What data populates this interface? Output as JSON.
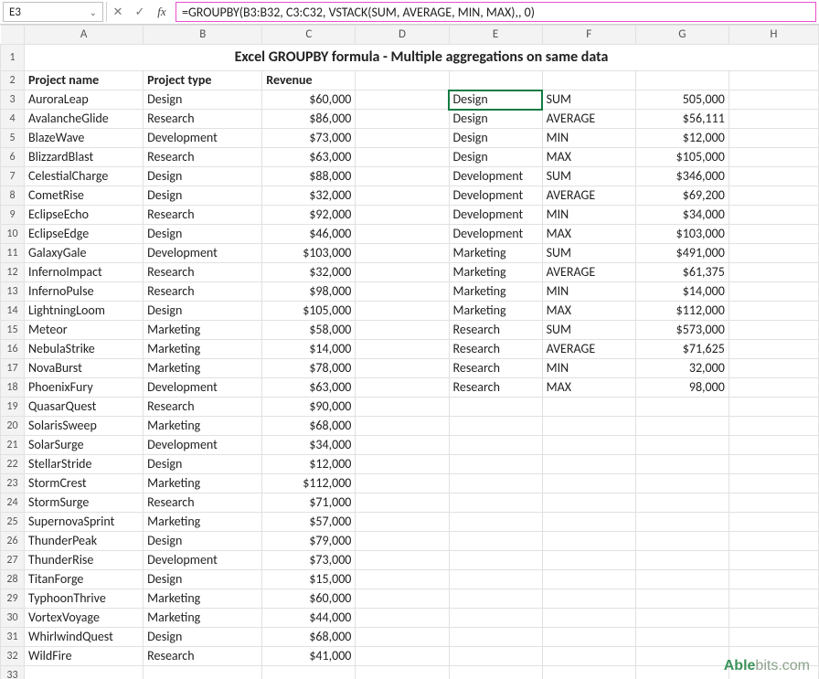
{
  "name_box": "E3",
  "formula": "=GROUPBY(B3:B32, C3:C32, VSTACK(SUM, AVERAGE, MIN, MAX),, 0)",
  "columns": [
    "A",
    "B",
    "C",
    "D",
    "E",
    "F",
    "G",
    "H"
  ],
  "title": "Excel GROUPBY formula - Multiple aggregations on same data",
  "headers": {
    "A": "Project name",
    "B": "Project type",
    "C": "Revenue"
  },
  "rows": [
    3,
    4,
    5,
    6,
    7,
    8,
    9,
    10,
    11,
    12,
    13,
    14,
    15,
    16,
    17,
    18,
    19,
    20,
    21,
    22,
    23,
    24,
    25,
    26,
    27,
    28,
    29,
    30,
    31,
    32,
    33
  ],
  "source_data": [
    {
      "name": "AuroraLeap",
      "type": "Design",
      "rev": "$60,000"
    },
    {
      "name": "AvalancheGlide",
      "type": "Research",
      "rev": "$86,000"
    },
    {
      "name": "BlazeWave",
      "type": "Development",
      "rev": "$73,000"
    },
    {
      "name": "BlizzardBlast",
      "type": "Research",
      "rev": "$63,000"
    },
    {
      "name": "CelestialCharge",
      "type": "Design",
      "rev": "$88,000"
    },
    {
      "name": "CometRise",
      "type": "Design",
      "rev": "$32,000"
    },
    {
      "name": "EclipseEcho",
      "type": "Research",
      "rev": "$92,000"
    },
    {
      "name": "EclipseEdge",
      "type": "Design",
      "rev": "$46,000"
    },
    {
      "name": "GalaxyGale",
      "type": "Development",
      "rev": "$103,000"
    },
    {
      "name": "InfernoImpact",
      "type": "Research",
      "rev": "$32,000"
    },
    {
      "name": "InfernoPulse",
      "type": "Research",
      "rev": "$98,000"
    },
    {
      "name": "LightningLoom",
      "type": "Design",
      "rev": "$105,000"
    },
    {
      "name": "Meteor",
      "type": "Marketing",
      "rev": "$58,000"
    },
    {
      "name": "NebulaStrike",
      "type": "Marketing",
      "rev": "$14,000"
    },
    {
      "name": "NovaBurst",
      "type": "Marketing",
      "rev": "$78,000"
    },
    {
      "name": "PhoenixFury",
      "type": "Development",
      "rev": "$63,000"
    },
    {
      "name": "QuasarQuest",
      "type": "Research",
      "rev": "$90,000"
    },
    {
      "name": "SolarisSweep",
      "type": "Marketing",
      "rev": "$68,000"
    },
    {
      "name": "SolarSurge",
      "type": "Development",
      "rev": "$34,000"
    },
    {
      "name": "StellarStride",
      "type": "Design",
      "rev": "$12,000"
    },
    {
      "name": "StormCrest",
      "type": "Marketing",
      "rev": "$112,000"
    },
    {
      "name": "StormSurge",
      "type": "Research",
      "rev": "$71,000"
    },
    {
      "name": "SupernovaSprint",
      "type": "Marketing",
      "rev": "$57,000"
    },
    {
      "name": "ThunderPeak",
      "type": "Design",
      "rev": "$79,000"
    },
    {
      "name": "ThunderRise",
      "type": "Development",
      "rev": "$73,000"
    },
    {
      "name": "TitanForge",
      "type": "Design",
      "rev": "$15,000"
    },
    {
      "name": "TyphoonThrive",
      "type": "Marketing",
      "rev": "$60,000"
    },
    {
      "name": "VortexVoyage",
      "type": "Marketing",
      "rev": "$44,000"
    },
    {
      "name": "WhirlwindQuest",
      "type": "Design",
      "rev": "$68,000"
    },
    {
      "name": "WildFire",
      "type": "Research",
      "rev": "$41,000"
    }
  ],
  "spill_data": [
    {
      "e": "Design",
      "f": "SUM",
      "g": "505,000"
    },
    {
      "e": "Design",
      "f": "AVERAGE",
      "g": "$56,111"
    },
    {
      "e": "Design",
      "f": "MIN",
      "g": "$12,000"
    },
    {
      "e": "Design",
      "f": "MAX",
      "g": "$105,000"
    },
    {
      "e": "Development",
      "f": "SUM",
      "g": "$346,000"
    },
    {
      "e": "Development",
      "f": "AVERAGE",
      "g": "$69,200"
    },
    {
      "e": "Development",
      "f": "MIN",
      "g": "$34,000"
    },
    {
      "e": "Development",
      "f": "MAX",
      "g": "$103,000"
    },
    {
      "e": "Marketing",
      "f": "SUM",
      "g": "$491,000"
    },
    {
      "e": "Marketing",
      "f": "AVERAGE",
      "g": "$61,375"
    },
    {
      "e": "Marketing",
      "f": "MIN",
      "g": "$14,000"
    },
    {
      "e": "Marketing",
      "f": "MAX",
      "g": "$112,000"
    },
    {
      "e": "Research",
      "f": "SUM",
      "g": "$573,000"
    },
    {
      "e": "Research",
      "f": "AVERAGE",
      "g": "$71,625"
    },
    {
      "e": "Research",
      "f": "MIN",
      "g": "32,000"
    },
    {
      "e": "Research",
      "f": "MAX",
      "g": "98,000"
    }
  ],
  "watermark_brand": "Able",
  "watermark_suffix": "bits.com",
  "icons": {
    "chevron": "⌄",
    "cancel": "✕",
    "enter": "✓",
    "fx": "fx"
  }
}
